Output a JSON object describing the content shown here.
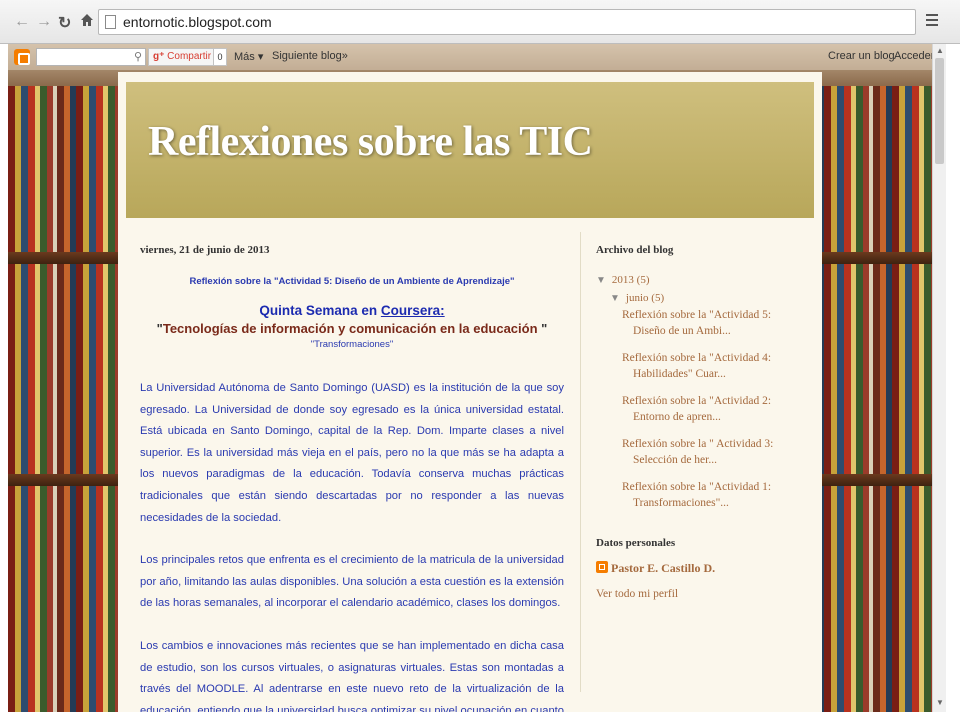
{
  "browser": {
    "url": "entornotic.blogspot.com"
  },
  "navbar": {
    "share_label": "Compartir",
    "share_count": "0",
    "more_label": "Más ▾",
    "next_blog_label": "Siguiente blog»",
    "create_blog_label": "Crear un blog",
    "sign_in_label": "Acceder"
  },
  "blog": {
    "title": "Reflexiones sobre las TIC"
  },
  "post": {
    "date": "viernes, 21 de junio de 2013",
    "heading": "Reflexión sobre la \"Actividad 5: Diseño de un Ambiente de Aprendizaje\"",
    "week_text": "Quinta Semana en ",
    "course_platform": "Coursera:",
    "course_name": "Tecnologías de información y comunicación en la educación",
    "quote_open": "\"",
    "quote_close": " \"",
    "transformations": "\"Transformaciones\"",
    "paragraphs": [
      "La Universidad Autónoma de Santo Domingo (UASD) es la institución de la que soy egresado. La Universidad de donde soy egresado es la única universidad estatal. Está ubicada en Santo Domingo, capital de la Rep. Dom. Imparte clases a nivel superior. Es la universidad más vieja en el país, pero no la que más se ha adapta a los nuevos paradigmas de la educación. Todavía conserva muchas prácticas tradicionales que están siendo descartadas por no responder a las nuevas necesidades de la sociedad.",
      "Los principales retos que enfrenta es el crecimiento de la matricula de la universidad por año, limitando las aulas disponibles. Una solución a esta cuestión es la extensión de las horas semanales, al incorporar el calendario académico, clases los domingos.",
      "Los cambios e innovaciones más recientes que se han implementado en dicha casa de estudio, son los cursos virtuales, o asignaturas virtuales. Estas son montadas a través del MOODLE. Al adentrarse en este nuevo reto de la virtualización de la educación, entiendo que la universidad busca optimizar su nivel ocupación en cuanto a las aulas y"
    ]
  },
  "sidebar": {
    "archive_title": "Archivo del blog",
    "year": "2013",
    "year_count": "(5)",
    "month": "junio",
    "month_count": "(5)",
    "posts": [
      "Reflexión sobre la \"Actividad 5: Diseño de un Ambi...",
      "Reflexión sobre la \"Actividad 4: Habilidades\" Cuar...",
      "Reflexión sobre la \"Actividad 2: Entorno de apren...",
      "Reflexión sobre la \" Actividad 3: Selección de her...",
      "Reflexión sobre la \"Actividad 1: Transformaciones\"..."
    ],
    "profile_title": "Datos personales",
    "profile_name": "Pastor E. Castillo D.",
    "profile_link": "Ver todo mi perfil"
  },
  "icons": {
    "back": "back-arrow-icon",
    "forward": "forward-arrow-icon",
    "reload": "reload-icon",
    "home": "home-icon",
    "menu": "hamburger-menu-icon",
    "search": "search-icon",
    "blogger": "blogger-logo-icon"
  },
  "colors": {
    "header_gold": "#c4b268",
    "post_text": "#2a3ab0",
    "sidebar_link": "#a56a3e",
    "blogger_orange": "#f57d00"
  }
}
